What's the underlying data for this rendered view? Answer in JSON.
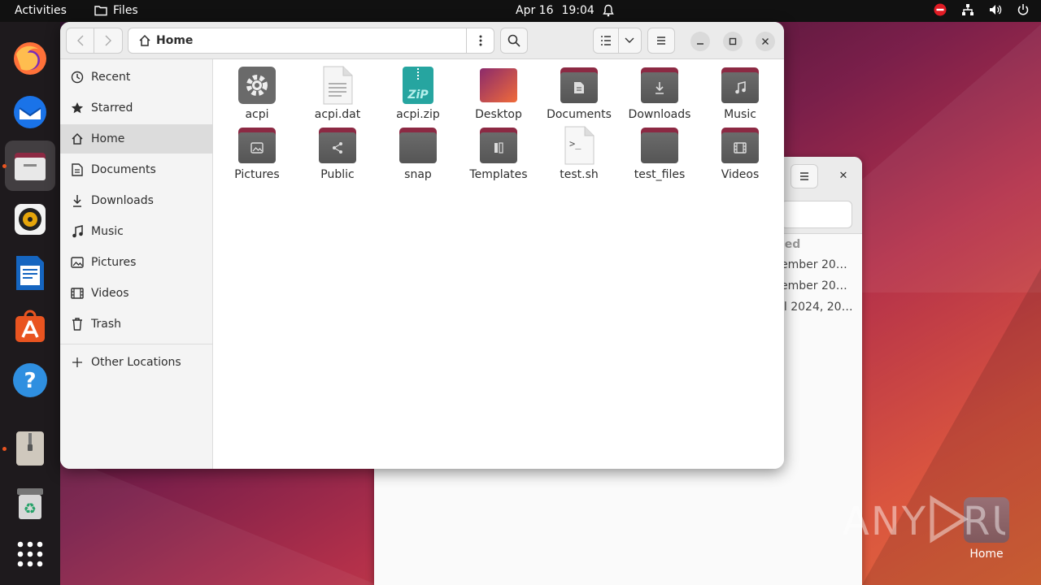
{
  "topbar": {
    "activities": "Activities",
    "app_name": "Files",
    "date": "Apr 16",
    "time": "19:04"
  },
  "dock": {
    "items": [
      "Firefox",
      "Thunderbird",
      "Files",
      "Rhythmbox",
      "LibreOffice Writer",
      "Ubuntu Software",
      "Help",
      "Archive Manager",
      "Trash",
      "Show Applications"
    ]
  },
  "window": {
    "path_label": "Home"
  },
  "sidebar": {
    "items": [
      {
        "label": "Recent",
        "icon": "clock-icon"
      },
      {
        "label": "Starred",
        "icon": "star-icon"
      },
      {
        "label": "Home",
        "icon": "home-icon"
      },
      {
        "label": "Documents",
        "icon": "document-icon"
      },
      {
        "label": "Downloads",
        "icon": "download-icon"
      },
      {
        "label": "Music",
        "icon": "music-icon"
      },
      {
        "label": "Pictures",
        "icon": "picture-icon"
      },
      {
        "label": "Videos",
        "icon": "video-icon"
      },
      {
        "label": "Trash",
        "icon": "trash-icon"
      }
    ],
    "other_locations": "Other Locations"
  },
  "files": [
    {
      "name": "acpi",
      "type": "executable"
    },
    {
      "name": "acpi.dat",
      "type": "text"
    },
    {
      "name": "acpi.zip",
      "type": "zip"
    },
    {
      "name": "Desktop",
      "type": "desktop-folder"
    },
    {
      "name": "Documents",
      "type": "folder"
    },
    {
      "name": "Downloads",
      "type": "folder"
    },
    {
      "name": "Music",
      "type": "folder"
    },
    {
      "name": "Pictures",
      "type": "folder"
    },
    {
      "name": "Public",
      "type": "folder"
    },
    {
      "name": "snap",
      "type": "folder"
    },
    {
      "name": "Templates",
      "type": "folder"
    },
    {
      "name": "test.sh",
      "type": "script"
    },
    {
      "name": "test_files",
      "type": "folder"
    },
    {
      "name": "Videos",
      "type": "folder"
    }
  ],
  "background_window": {
    "column_header": "ied",
    "rows": [
      "ember 20…",
      "ember 20…",
      "il 2024, 20…"
    ]
  },
  "desktop": {
    "home_label": "Home",
    "watermark": "ANY RUN"
  },
  "colors": {
    "accent": "#e95420",
    "folder_tab": "#8c2943",
    "selected_row": "#dcdcdc"
  }
}
